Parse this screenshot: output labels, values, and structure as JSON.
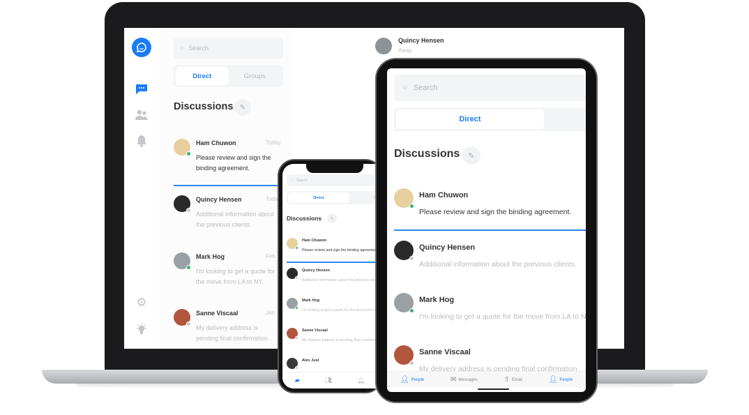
{
  "search_placeholder": "Search",
  "tabs": {
    "direct": "Direct",
    "groups": "Groups"
  },
  "discussions_title": "Discussions",
  "active_chat": {
    "name": "Quincy Hensen",
    "status": "Away"
  },
  "conversations": [
    {
      "name": "Ham Chuwon",
      "date": "Today",
      "message": "Please review and sign the binding agreement.",
      "message_line1": "Please review and sign the",
      "message_line2": "binding agreement.",
      "online": true,
      "unread": true,
      "avatar_color": "#e8cf9f"
    },
    {
      "name": "Quincy Hensen",
      "date": "Today",
      "message": "Additional information about the previous clients.",
      "message_line1": "Additional information about",
      "message_line2": "the previous clients.",
      "online": false,
      "unread": false,
      "avatar_color": "#2a2a2a"
    },
    {
      "name": "Mark Hog",
      "date": "Feb",
      "message": "I'm looking to get a quote for the move from LA to NY.",
      "message_line1": "I'm looking to get a quote for",
      "message_line2": "the move from LA to NY.",
      "online": true,
      "unread": false,
      "avatar_color": "#9aa0a4"
    },
    {
      "name": "Sanne Viscaal",
      "date": "Jan",
      "message": "My delivery address is pending final confirmation.",
      "message_line1": "My delivery address is",
      "message_line2": "pending final confirmation.",
      "online": false,
      "unread": false,
      "avatar_color": "#b0563c"
    },
    {
      "name": "Alex Just",
      "online": false,
      "avatar_color": "#3a3a3a"
    }
  ],
  "tablet_bottom_bar": [
    {
      "label": "People",
      "icon": "people-icon",
      "active": true
    },
    {
      "label": "Messages",
      "icon": "envelope-icon",
      "active": false
    },
    {
      "label": "Email",
      "icon": "upload-icon",
      "active": false
    },
    {
      "label": "People",
      "icon": "people-icon",
      "active": true
    }
  ],
  "colors": {
    "accent": "#1a7cf5",
    "online": "#3db36b",
    "offline": "#c8c8c8"
  }
}
